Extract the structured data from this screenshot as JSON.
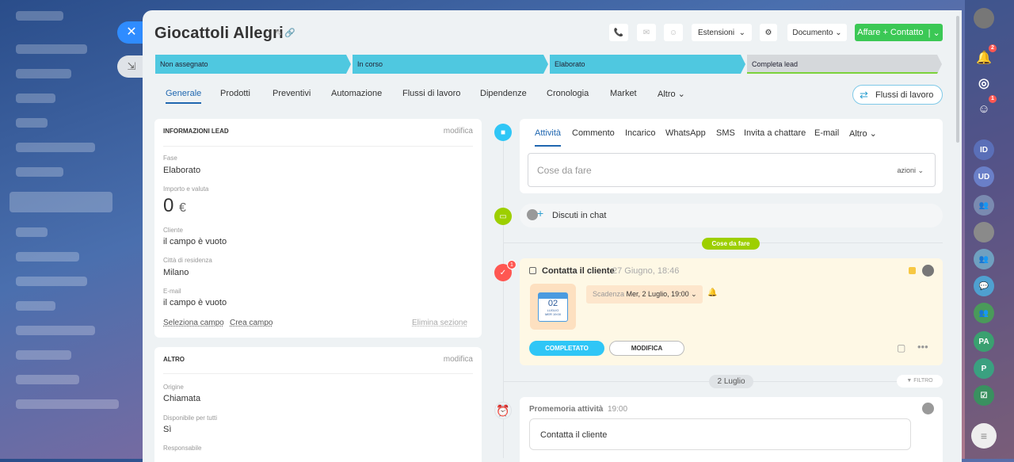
{
  "header": {
    "title": "Giocattoli Allegri",
    "estensioni": "Estensioni",
    "documento": "Documento",
    "affare_contatto": "Affare + Contatto"
  },
  "stages": [
    "Non assegnato",
    "In corso",
    "Elaborato",
    "Completa lead"
  ],
  "tabs": [
    "Generale",
    "Prodotti",
    "Preventivi",
    "Automazione",
    "Flussi di lavoro",
    "Dipendenze",
    "Cronologia",
    "Market",
    "Altro"
  ],
  "flussi_button": "Flussi di lavoro",
  "info_card": {
    "title": "INFORMAZIONI LEAD",
    "edit": "modifica",
    "fase_label": "Fase",
    "fase_value": "Elaborato",
    "importo_label": "Importo e valuta",
    "importo_value": "0",
    "currency": "€",
    "cliente_label": "Cliente",
    "cliente_value": "il campo è vuoto",
    "citta_label": "Città di residenza",
    "citta_value": "Milano",
    "email_label": "E-mail",
    "email_value": "il campo è vuoto",
    "seleziona": "Seleziona campo",
    "crea": "Crea campo",
    "elimina": "Elimina sezione"
  },
  "altro_card": {
    "title": "ALTRO",
    "edit": "modifica",
    "origine_label": "Origine",
    "origine_value": "Chiamata",
    "disponibile_label": "Disponibile per tutti",
    "disponibile_value": "Sì",
    "responsabile_label": "Responsabile"
  },
  "activity": {
    "tabs": [
      "Attività",
      "Commento",
      "Incarico",
      "WhatsApp",
      "SMS",
      "Invita a chattare",
      "E-mail",
      "Altro"
    ],
    "placeholder": "Cose da fare",
    "azioni": "azioni"
  },
  "discuti": "Discuti in chat",
  "cose_da_fare_tag": "Cose da fare",
  "task": {
    "title": "Contatta il cliente",
    "created": "27 Giugno, 18:46",
    "cal_day": "02",
    "cal_month": "LUGLIO",
    "cal_sub": "MER 19:00",
    "scadenza_label": "Scadenza",
    "scadenza_value": "Mer, 2 Luglio, 19:00",
    "completato": "COMPLETATO",
    "modifica": "MODIFICA",
    "badge": "1"
  },
  "date_divider": "2 Luglio",
  "filtro": "FILTRO",
  "reminder": {
    "title": "Promemoria attività",
    "time": "19:00",
    "text": "Contatta il cliente"
  },
  "rightbar": {
    "notif_badge": "2",
    "chat_badge": "1",
    "avatars": [
      "ID",
      "UD",
      "",
      "",
      "",
      "",
      "",
      "PA",
      "P",
      ""
    ]
  }
}
